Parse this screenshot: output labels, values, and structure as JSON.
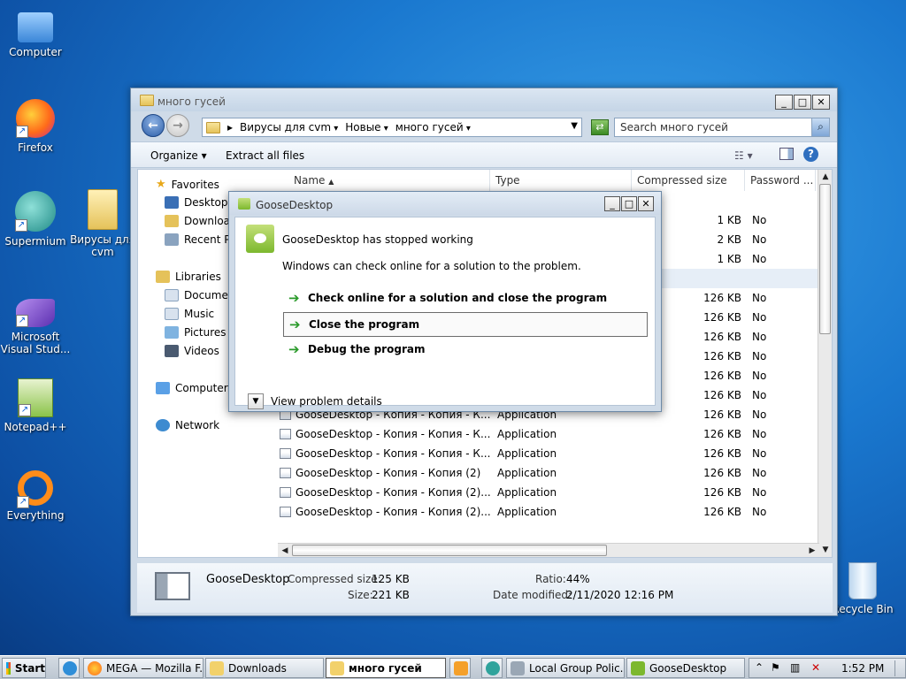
{
  "desktop": {
    "icons": [
      {
        "label": "Computer",
        "icon": "computer-icon",
        "color": "#5aa0e6"
      },
      {
        "label": "Firefox",
        "icon": "firefox-icon",
        "color": "#ff7a1a"
      },
      {
        "label": "Supermium",
        "icon": "supermium-icon",
        "color": "#3aa8a0"
      },
      {
        "label": "Microsoft Visual Stud...",
        "icon": "visual-studio-icon",
        "color": "#7b4fc4"
      },
      {
        "label": "Notepad++",
        "icon": "notepadpp-icon",
        "color": "#8bc34a"
      },
      {
        "label": "Everything",
        "icon": "everything-icon",
        "color": "#ff8c1a"
      },
      {
        "label": "Вирусы для cvm",
        "icon": "folder-icon",
        "color": "#f2d16b"
      },
      {
        "label": "Recycle Bin",
        "icon": "recycle-bin-icon",
        "color": "#cfe3f5"
      }
    ]
  },
  "explorer": {
    "title": "много гусей",
    "breadcrumb": [
      "Вирусы для cvm",
      "Новые",
      "много гусей"
    ],
    "search_placeholder": "Search много гусей",
    "toolbar": {
      "organize": "Organize",
      "extract": "Extract all files"
    },
    "nav": {
      "favorites": "Favorites",
      "favorites_items": [
        "Desktop",
        "Downloads",
        "Recent Places"
      ],
      "libraries": "Libraries",
      "libraries_items": [
        "Documents",
        "Music",
        "Pictures",
        "Videos"
      ],
      "computer": "Computer",
      "network": "Network"
    },
    "columns": [
      "Name",
      "Type",
      "Compressed size",
      "Password ..."
    ],
    "files": [
      {
        "name": "",
        "type": "",
        "size": "1 KB",
        "password": "No"
      },
      {
        "name": "",
        "type": "",
        "size": "2 KB",
        "password": "No"
      },
      {
        "name": "",
        "type": "",
        "size": "1 KB",
        "password": "No"
      },
      {
        "name": "",
        "type": "",
        "size": "",
        "password": ""
      },
      {
        "name": "",
        "type": "",
        "size": "126 KB",
        "password": "No"
      },
      {
        "name": "",
        "type": "",
        "size": "126 KB",
        "password": "No"
      },
      {
        "name": "",
        "type": "",
        "size": "126 KB",
        "password": "No"
      },
      {
        "name": "",
        "type": "",
        "size": "126 KB",
        "password": "No"
      },
      {
        "name": "",
        "type": "",
        "size": "126 KB",
        "password": "No"
      },
      {
        "name": "GooseDesktop - Копия - Копия - К...",
        "type": "Application",
        "size": "126 KB",
        "password": "No"
      },
      {
        "name": "GooseDesktop - Копия - Копия - К...",
        "type": "Application",
        "size": "126 KB",
        "password": "No"
      },
      {
        "name": "GooseDesktop - Копия - Копия - К...",
        "type": "Application",
        "size": "126 KB",
        "password": "No"
      },
      {
        "name": "GooseDesktop - Копия - Копия - К...",
        "type": "Application",
        "size": "126 KB",
        "password": "No"
      },
      {
        "name": "GooseDesktop - Копия - Копия (2)",
        "type": "Application",
        "size": "126 KB",
        "password": "No"
      },
      {
        "name": "GooseDesktop - Копия - Копия (2)...",
        "type": "Application",
        "size": "126 KB",
        "password": "No"
      },
      {
        "name": "GooseDesktop - Копия - Копия (2)...",
        "type": "Application",
        "size": "126 KB",
        "password": "No"
      }
    ],
    "details": {
      "name": "GooseDesktop",
      "compressed_label": "Compressed size:",
      "compressed_value": "125 KB",
      "size_label": "Size:",
      "size_value": "221 KB",
      "ratio_label": "Ratio:",
      "ratio_value": "44%",
      "modified_label": "Date modified:",
      "modified_value": "2/11/2020 12:16 PM"
    }
  },
  "dialog": {
    "title": "GooseDesktop",
    "heading": "GooseDesktop has stopped working",
    "message": "Windows can check online for a solution to the problem.",
    "options": [
      "Check online for a solution and close the program",
      "Close the program",
      "Debug the program"
    ],
    "details_toggle": "View problem details"
  },
  "taskbar": {
    "start": "Start",
    "items": [
      {
        "label": "MEGA — Mozilla F...",
        "color": "#ff7a1a"
      },
      {
        "label": "Downloads",
        "color": "#f2d16b"
      },
      {
        "label": "много гусей",
        "color": "#f2d16b"
      },
      {
        "label": "Local Group Polic...",
        "color": "#9aa7b5"
      },
      {
        "label": "GooseDesktop",
        "color": "#7cb82e"
      }
    ],
    "clock": "1:52 PM"
  }
}
